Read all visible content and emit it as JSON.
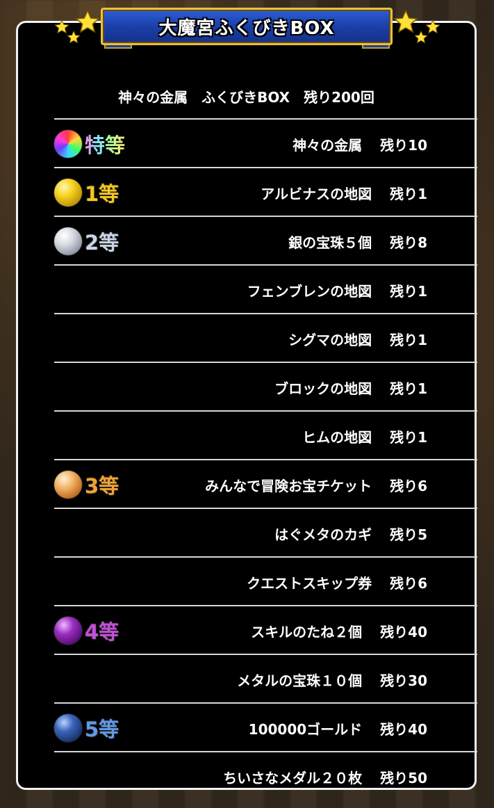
{
  "header": {
    "title": "大魔宮ふくびきBOX",
    "subtitle": "神々の金属　ふくびきBOX　残り200回"
  },
  "rows": [
    {
      "grade": "特等",
      "orb": "rainbow-orb-icon",
      "name": "神々の金属",
      "remaining": "残り10"
    },
    {
      "grade": "1等",
      "orb": "gold-orb-icon",
      "name": "アルビナスの地図",
      "remaining": "残り1"
    },
    {
      "grade": "2等",
      "orb": "silver-orb-icon",
      "name": "銀の宝珠５個",
      "remaining": "残り8"
    },
    {
      "grade": "",
      "orb": "",
      "name": "フェンブレンの地図",
      "remaining": "残り1"
    },
    {
      "grade": "",
      "orb": "",
      "name": "シグマの地図",
      "remaining": "残り1"
    },
    {
      "grade": "",
      "orb": "",
      "name": "ブロックの地図",
      "remaining": "残り1"
    },
    {
      "grade": "",
      "orb": "",
      "name": "ヒムの地図",
      "remaining": "残り1"
    },
    {
      "grade": "3等",
      "orb": "bronze-orb-icon",
      "name": "みんなで冒険お宝チケット",
      "remaining": "残り6"
    },
    {
      "grade": "",
      "orb": "",
      "name": "はぐメタのカギ",
      "remaining": "残り5"
    },
    {
      "grade": "",
      "orb": "",
      "name": "クエストスキップ券",
      "remaining": "残り6"
    },
    {
      "grade": "4等",
      "orb": "purple-orb-icon",
      "name": "スキルのたね２個",
      "remaining": "残り40"
    },
    {
      "grade": "",
      "orb": "",
      "name": "メタルの宝珠１０個",
      "remaining": "残り30"
    },
    {
      "grade": "5等",
      "orb": "blue-orb-icon",
      "name": "100000ゴールド",
      "remaining": "残り40"
    },
    {
      "grade": "",
      "orb": "",
      "name": "ちいさなメダル２０枚",
      "remaining": "残り50"
    }
  ],
  "colors": {
    "panel_bg": "#000000",
    "panel_border": "#f2f2f2",
    "banner_blue": "#1b3fa8",
    "banner_gold": "#e8c23c",
    "grade_special": "rainbow",
    "grade_1": "#f6c51e",
    "grade_2": "#c9d4e6",
    "grade_3": "#f2a232",
    "grade_4": "#c24fd8",
    "grade_5": "#5f9ae8"
  }
}
